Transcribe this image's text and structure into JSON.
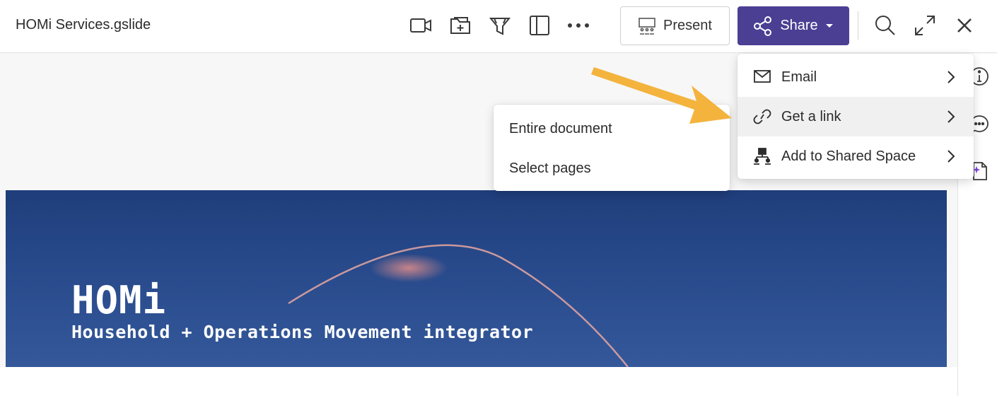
{
  "header": {
    "doc_title": "HOMi Services.gslide",
    "toolbar_icons": [
      "video-icon",
      "add-folder-icon",
      "funnel-icon",
      "sidebar-panel-icon",
      "more-icon"
    ],
    "present_label": "Present",
    "share_label": "Share",
    "right_icons": [
      "search-icon",
      "expand-icon",
      "close-icon"
    ]
  },
  "share_menu": {
    "items": [
      {
        "label": "Email",
        "icon": "mail-icon"
      },
      {
        "label": "Get a link",
        "icon": "link-icon"
      },
      {
        "label": "Add to Shared Space",
        "icon": "shared-space-icon"
      }
    ]
  },
  "link_submenu": {
    "items": [
      {
        "label": "Entire document"
      },
      {
        "label": "Select pages"
      }
    ]
  },
  "right_rail": {
    "icons": [
      "info-icon",
      "comment-icon",
      "ai-document-icon"
    ]
  },
  "slide": {
    "title": "HOMi",
    "subtitle": "Household + Operations Movement integrator"
  },
  "colors": {
    "share_button": "#4a3f93",
    "annotation_arrow": "#f3b33d",
    "slide_background": "#27498a"
  }
}
